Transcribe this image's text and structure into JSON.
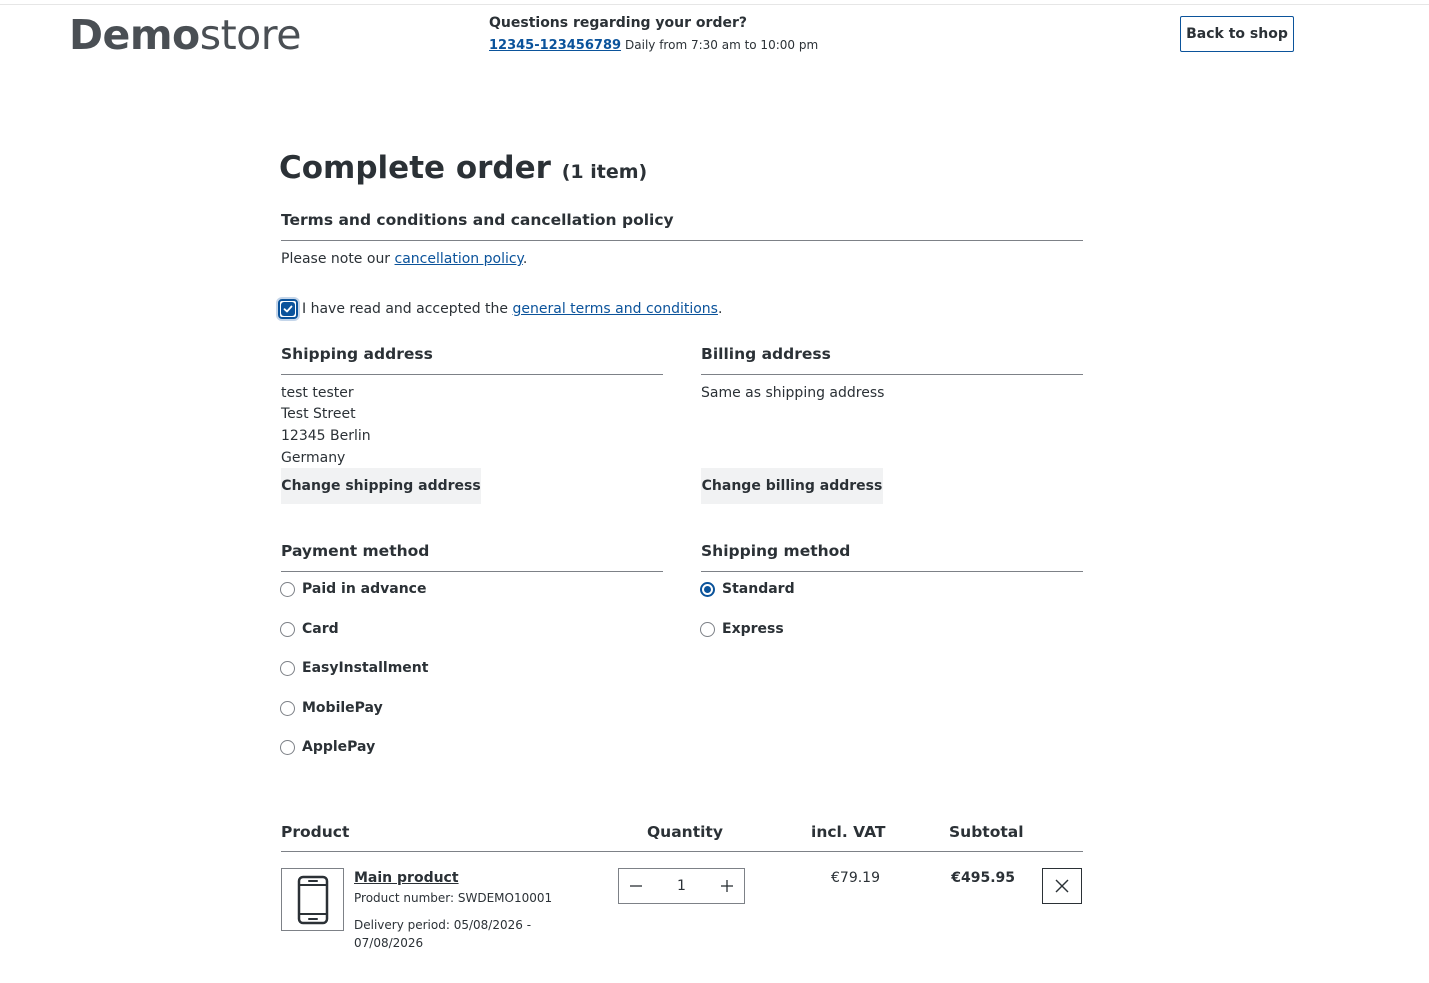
{
  "header": {
    "logo_bold": "Demo",
    "logo_light": "store",
    "contact_title": "Questions regarding your order?",
    "phone": "12345-123456789",
    "hours": "Daily from 7:30 am to 10:00 pm",
    "back_label": "Back to shop"
  },
  "page": {
    "title": "Complete order",
    "item_count": "(1 item)"
  },
  "terms": {
    "title": "Terms and conditions and cancellation policy",
    "note_prefix": "Please note our ",
    "note_link": "cancellation policy",
    "note_suffix": ".",
    "checkbox_prefix": "I have read and accepted the ",
    "checkbox_link": "general terms and conditions",
    "checkbox_suffix": ".",
    "accepted": true
  },
  "shipping_address": {
    "title": "Shipping address",
    "lines": [
      "test tester",
      "Test Street",
      "12345 Berlin",
      "Germany"
    ],
    "change_label": "Change shipping address"
  },
  "billing_address": {
    "title": "Billing address",
    "text": "Same as shipping address",
    "change_label": "Change billing address"
  },
  "payment": {
    "title": "Payment method",
    "options": [
      {
        "label": "Paid in advance",
        "selected": false
      },
      {
        "label": "Card",
        "selected": false
      },
      {
        "label": "EasyInstallment",
        "selected": false
      },
      {
        "label": "MobilePay",
        "selected": false
      },
      {
        "label": "ApplePay",
        "selected": false
      }
    ]
  },
  "shipping_method": {
    "title": "Shipping method",
    "options": [
      {
        "label": "Standard",
        "selected": true
      },
      {
        "label": "Express",
        "selected": false
      }
    ]
  },
  "cart": {
    "headers": {
      "product": "Product",
      "quantity": "Quantity",
      "unit_price": "incl. VAT",
      "subtotal": "Subtotal"
    },
    "items": [
      {
        "name": "Main product",
        "number": "Product number: SWDEMO10001",
        "delivery_line1": "Delivery period: 05/08/2026 -",
        "delivery_line2": "07/08/2026",
        "quantity": "1",
        "unit_price": "€79.19",
        "subtotal": "€495.95",
        "icon": "smartphone-icon"
      }
    ]
  },
  "colors": {
    "accent": "#0b539b",
    "text": "#2b3136",
    "rule": "#7d8187",
    "button_bg": "#f1f2f3"
  }
}
